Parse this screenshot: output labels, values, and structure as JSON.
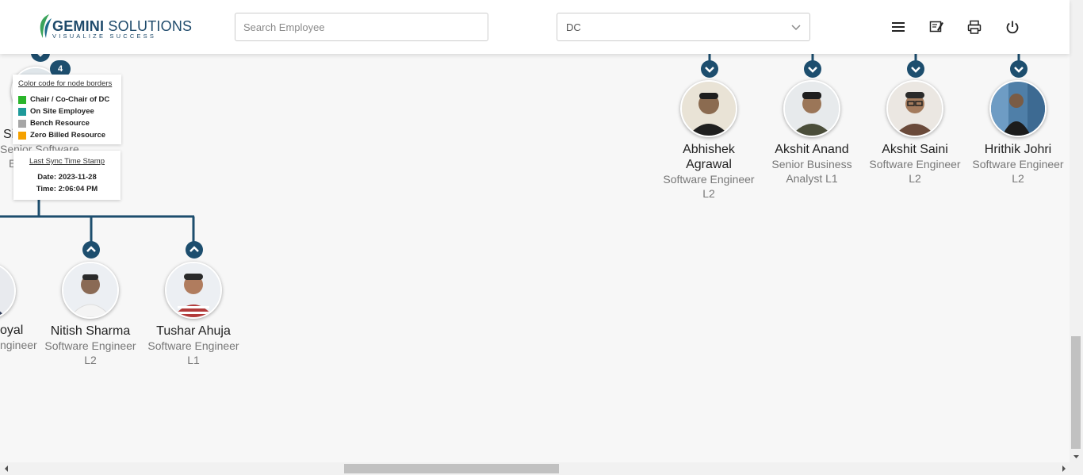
{
  "header": {
    "logo": {
      "brand_bold": "GEMINI",
      "brand_thin": " SOLUTIONS",
      "tagline": "VISUALIZE SUCCESS"
    },
    "search": {
      "placeholder": "Search Employee",
      "value": ""
    },
    "dc_select": {
      "value": "DC"
    },
    "icons": [
      "menu-icon",
      "feedback-icon",
      "print-icon",
      "power-icon"
    ]
  },
  "legend": {
    "title": "Color code for node borders",
    "items": [
      {
        "label": "Chair / Co-Chair of DC",
        "color": "#2bb52b"
      },
      {
        "label": "On Site Employee",
        "color": "#1f9a9a"
      },
      {
        "label": "Bench Resource",
        "color": "#a6a6a6"
      },
      {
        "label": "Zero Billed Resource",
        "color": "#f5a100"
      }
    ]
  },
  "sync": {
    "title": "Last Sync Time Stamp",
    "date": "Date: 2023-11-28",
    "time": "Time: 2:06:04 PM"
  },
  "parent_node": {
    "name_partial": "Si",
    "role_partial": "Senior Software",
    "role_partial_2": "E",
    "child_count": "4"
  },
  "bottom_nodes": [
    {
      "name": "oyal",
      "role": "ngineer",
      "role2": ""
    },
    {
      "name": "Nitish Sharma",
      "role": "Software Engineer",
      "role2": "L2"
    },
    {
      "name": "Tushar Ahuja",
      "role": "Software Engineer",
      "role2": "L1"
    }
  ],
  "top_nodes": [
    {
      "name": "Abhishek",
      "name2": "Agrawal",
      "role": "Software Engineer",
      "role2": "L2"
    },
    {
      "name": "Akshit Anand",
      "name2": "",
      "role": "Senior Business",
      "role2": "Analyst L1"
    },
    {
      "name": "Akshit Saini",
      "name2": "",
      "role": "Software Engineer",
      "role2": "L2"
    },
    {
      "name": "Hrithik Johri",
      "name2": "",
      "role": "Software Engineer",
      "role2": "L2"
    }
  ],
  "colors": {
    "accent": "#1d4e6e",
    "header_bg": "#ffffff",
    "page_bg": "#f7f7f7"
  }
}
